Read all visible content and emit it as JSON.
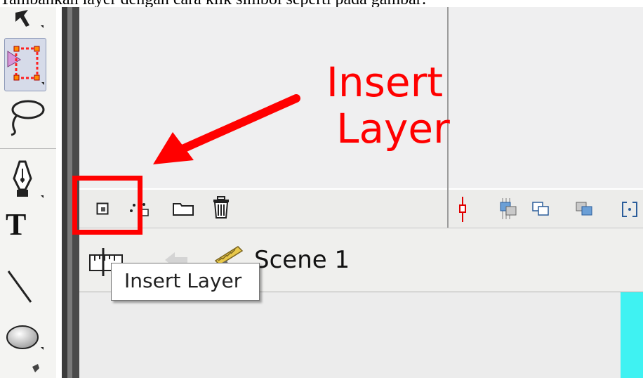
{
  "caption": "Tambahkan layer dengan cara klik simbol seperti pada gambar:",
  "annotation": {
    "line1": "Insert",
    "line2": "Layer"
  },
  "tooltip": {
    "text": "Insert Layer"
  },
  "editbar": {
    "scene_label": "Scene 1"
  },
  "toolbar": {
    "tools": [
      "subselection-tool-icon",
      "free-transform-tool-icon",
      "lasso-tool-icon",
      "pen-tool-icon",
      "text-tool-icon",
      "line-tool-icon",
      "oval-tool-icon",
      "pencil-tool-icon"
    ],
    "text_tool_glyph": "T"
  },
  "timeline_buttons": [
    "insert-layer-icon",
    "add-motion-guide-icon",
    "insert-layer-folder-icon",
    "delete-layer-icon"
  ],
  "colors": {
    "annotation": "#ff0000",
    "stage_accent": "#3ff2f2"
  }
}
